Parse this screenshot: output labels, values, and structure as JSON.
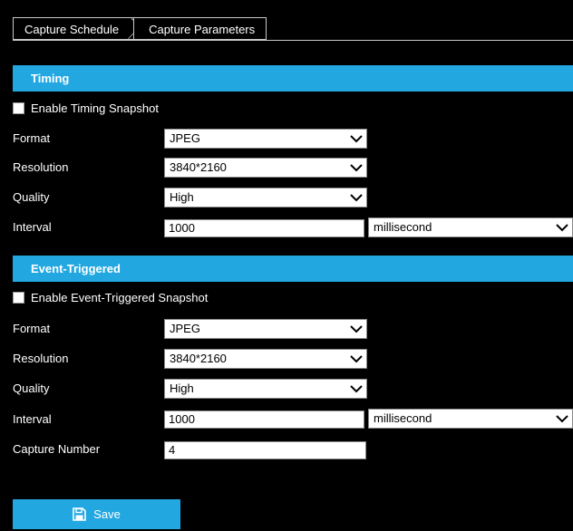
{
  "tabs": {
    "schedule": "Capture Schedule",
    "parameters": "Capture Parameters"
  },
  "timing": {
    "header": "Timing",
    "enable_label": "Enable Timing Snapshot",
    "enabled": false,
    "format_label": "Format",
    "format_value": "JPEG",
    "resolution_label": "Resolution",
    "resolution_value": "3840*2160",
    "quality_label": "Quality",
    "quality_value": "High",
    "interval_label": "Interval",
    "interval_value": "1000",
    "interval_unit": "millisecond"
  },
  "event": {
    "header": "Event-Triggered",
    "enable_label": "Enable Event-Triggered Snapshot",
    "enabled": false,
    "format_label": "Format",
    "format_value": "JPEG",
    "resolution_label": "Resolution",
    "resolution_value": "3840*2160",
    "quality_label": "Quality",
    "quality_value": "High",
    "interval_label": "Interval",
    "interval_value": "1000",
    "interval_unit": "millisecond",
    "capture_number_label": "Capture Number",
    "capture_number_value": "4"
  },
  "save_label": "Save",
  "colors": {
    "accent": "#22a7e0",
    "background": "#000000"
  },
  "icons": {
    "save": "floppy-disk-icon",
    "dropdown": "chevron-down-icon"
  }
}
